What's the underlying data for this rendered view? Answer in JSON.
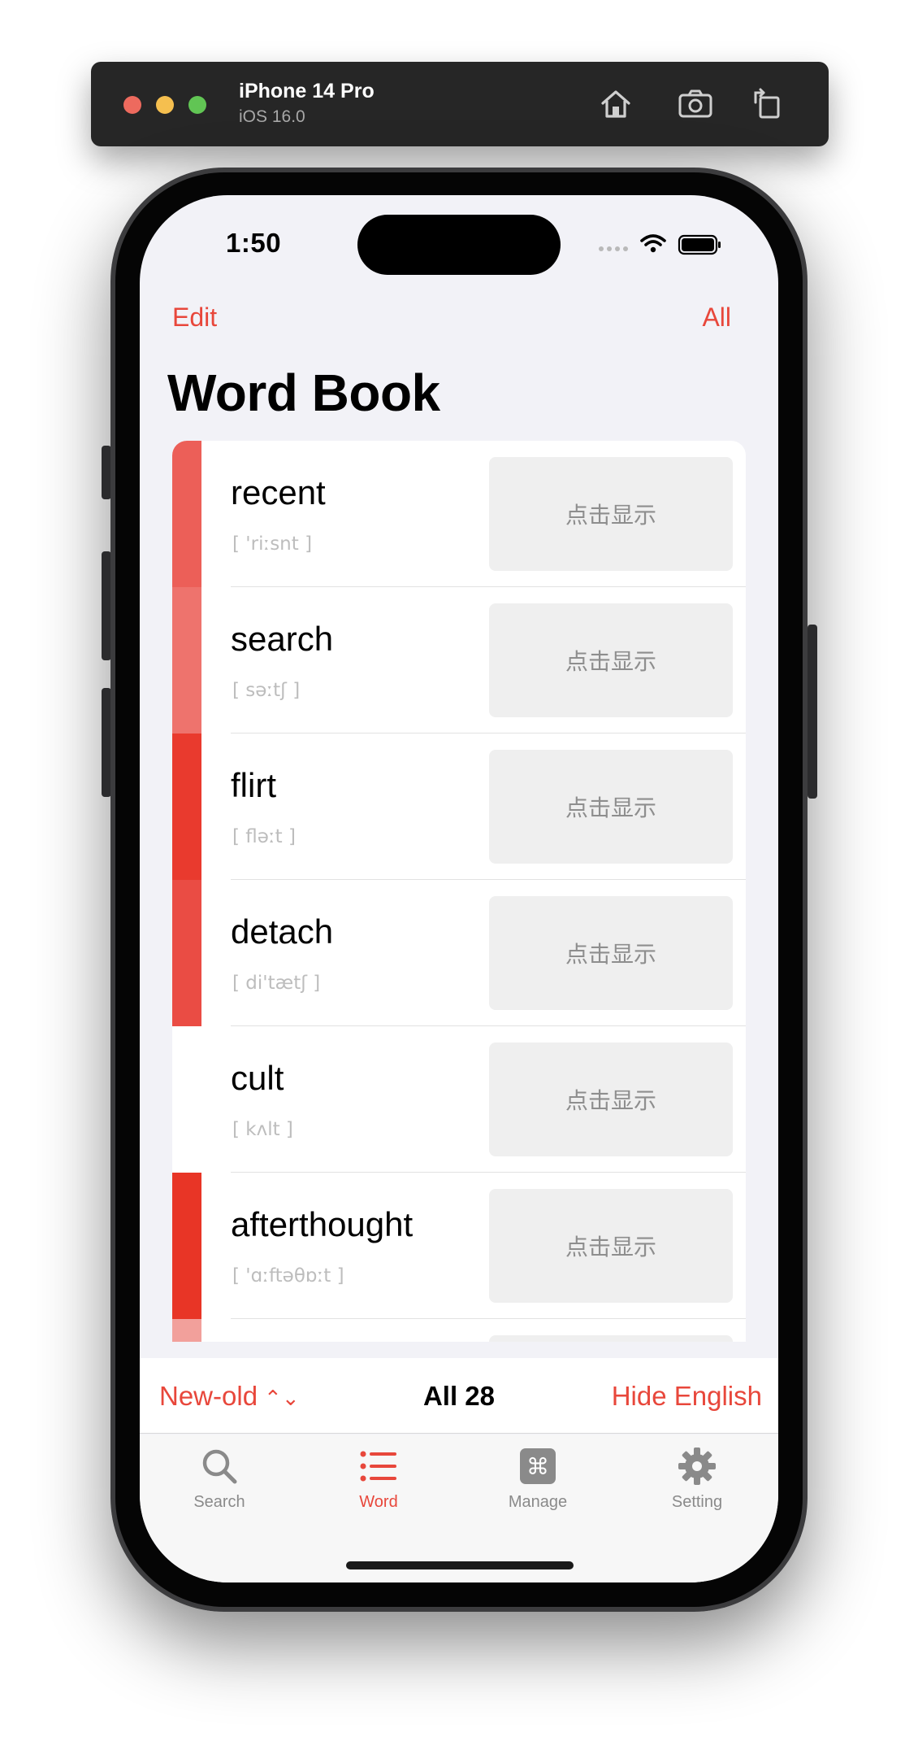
{
  "simulator": {
    "device": "iPhone 14 Pro",
    "os": "iOS 16.0"
  },
  "status_bar": {
    "time": "1:50"
  },
  "nav": {
    "left": "Edit",
    "right": "All"
  },
  "page_title": "Word Book",
  "words": [
    {
      "word": "recent",
      "ipa": "[ 'riːsnt ]",
      "reveal": "点击显示",
      "color": "#ec5f58"
    },
    {
      "word": "search",
      "ipa": "[ səːtʃ ]",
      "reveal": "点击显示",
      "color": "#ee736d"
    },
    {
      "word": "flirt",
      "ipa": "[ fləːt ]",
      "reveal": "点击显示",
      "color": "#e93a2e"
    },
    {
      "word": "detach",
      "ipa": "[ di'tætʃ ]",
      "reveal": "点击显示",
      "color": "#ea4c44"
    },
    {
      "word": "cult",
      "ipa": "[ kʌlt ]",
      "reveal": "点击显示",
      "color": "#ffffff"
    },
    {
      "word": "afterthought",
      "ipa": "[ 'ɑːftəθɒːt ]",
      "reveal": "点击显示",
      "color": "#e83526"
    },
    {
      "word": "",
      "ipa": "",
      "reveal": "",
      "color": "#f2a09b"
    }
  ],
  "sort_bar": {
    "order": "New-old",
    "count": "All 28",
    "toggle": "Hide English"
  },
  "tabs": [
    {
      "label": "Search",
      "icon": "magnifier",
      "active": false
    },
    {
      "label": "Word",
      "icon": "list",
      "active": true
    },
    {
      "label": "Manage",
      "icon": "command",
      "active": false
    },
    {
      "label": "Setting",
      "icon": "gear",
      "active": false
    }
  ],
  "colors": {
    "accent": "#e8473b",
    "background": "#f2f2f7"
  }
}
